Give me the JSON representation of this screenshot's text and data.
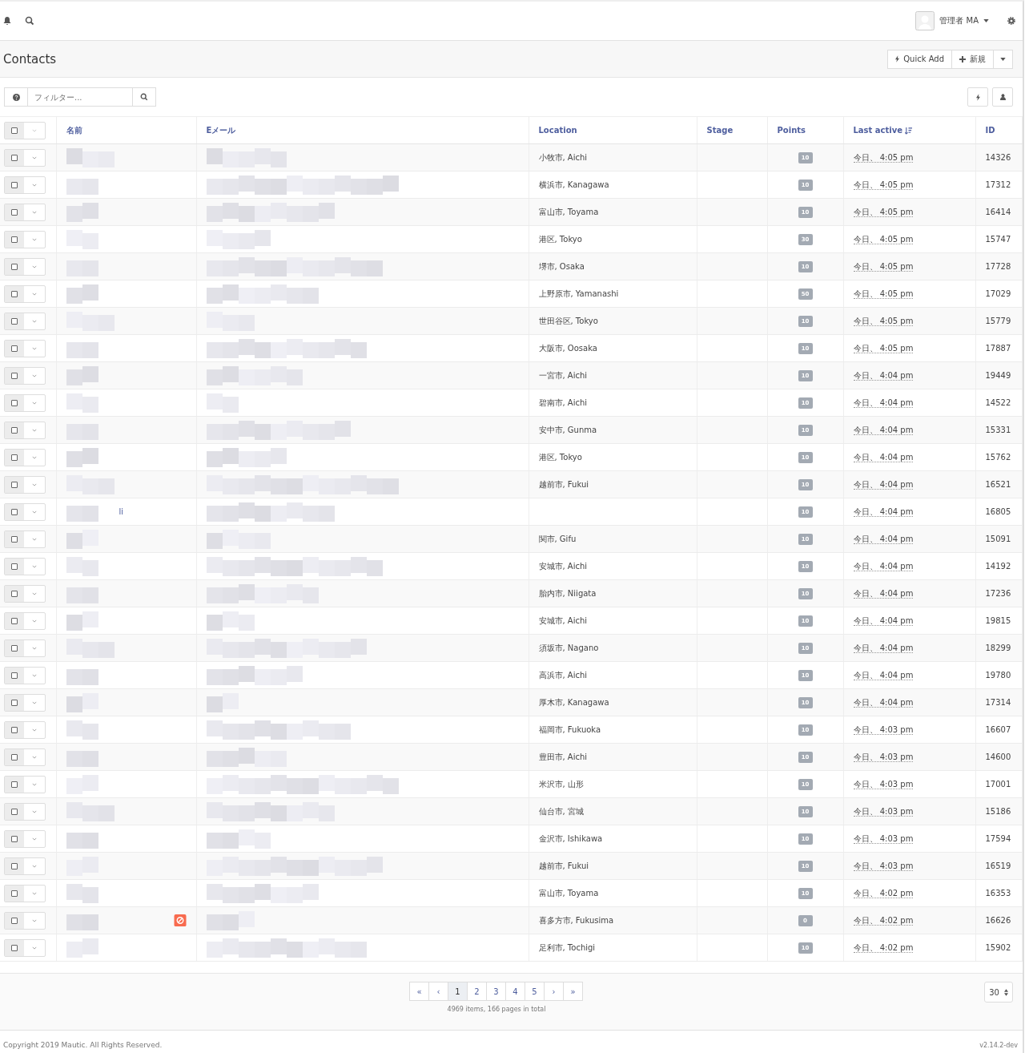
{
  "topbar": {
    "user_name": "管理者 MA"
  },
  "page": {
    "title": "Contacts",
    "buttons": [
      {
        "kind": "quick",
        "label": "Quick Add"
      },
      {
        "kind": "new",
        "label": "新規"
      }
    ]
  },
  "filter": {
    "placeholder": "フィルター..."
  },
  "table": {
    "columns": [
      "名前",
      "Eメール",
      "Location",
      "Stage",
      "Points",
      "Last active",
      "ID"
    ],
    "rows": [
      {
        "name": "",
        "location": "小牧市, Aichi",
        "points": "10",
        "last_active": "今日、 4:05 pm",
        "id": "14326",
        "do_not_contact": false
      },
      {
        "name": "",
        "location": "横浜市, Kanagawa",
        "points": "10",
        "last_active": "今日、 4:05 pm",
        "id": "17312",
        "do_not_contact": false
      },
      {
        "name": "",
        "location": "富山市, Toyama",
        "points": "10",
        "last_active": "今日、 4:05 pm",
        "id": "16414",
        "do_not_contact": false
      },
      {
        "name": "",
        "location": "港区, Tokyo",
        "points": "30",
        "last_active": "今日、 4:05 pm",
        "id": "15747",
        "do_not_contact": false
      },
      {
        "name": "",
        "location": "堺市, Osaka",
        "points": "10",
        "last_active": "今日、 4:05 pm",
        "id": "17728",
        "do_not_contact": false
      },
      {
        "name": "",
        "location": "上野原市, Yamanashi",
        "points": "50",
        "last_active": "今日、 4:05 pm",
        "id": "17029",
        "do_not_contact": false
      },
      {
        "name": "",
        "location": "世田谷区, Tokyo",
        "points": "10",
        "last_active": "今日、 4:05 pm",
        "id": "15779",
        "do_not_contact": false
      },
      {
        "name": "",
        "location": "大阪市, Oosaka",
        "points": "10",
        "last_active": "今日、 4:05 pm",
        "id": "17887",
        "do_not_contact": false
      },
      {
        "name": "",
        "location": "一宮市, Aichi",
        "points": "10",
        "last_active": "今日、 4:04 pm",
        "id": "19449",
        "do_not_contact": false
      },
      {
        "name": "",
        "location": "碧南市, Aichi",
        "points": "10",
        "last_active": "今日、 4:04 pm",
        "id": "14522",
        "do_not_contact": false
      },
      {
        "name": "",
        "location": "安中市, Gunma",
        "points": "10",
        "last_active": "今日、 4:04 pm",
        "id": "15331",
        "do_not_contact": false
      },
      {
        "name": "",
        "location": "港区, Tokyo",
        "points": "10",
        "last_active": "今日、 4:04 pm",
        "id": "15762",
        "do_not_contact": false
      },
      {
        "name": "",
        "location": "越前市, Fukui",
        "points": "10",
        "last_active": "今日、 4:04 pm",
        "id": "16521",
        "do_not_contact": false
      },
      {
        "name": "li",
        "location": "",
        "points": "10",
        "last_active": "今日、 4:04 pm",
        "id": "16805",
        "do_not_contact": false
      },
      {
        "name": "",
        "location": "関市, Gifu",
        "points": "10",
        "last_active": "今日、 4:04 pm",
        "id": "15091",
        "do_not_contact": false
      },
      {
        "name": "",
        "location": "安城市, Aichi",
        "points": "10",
        "last_active": "今日、 4:04 pm",
        "id": "14192",
        "do_not_contact": false
      },
      {
        "name": "",
        "location": "胎内市, Niigata",
        "points": "10",
        "last_active": "今日、 4:04 pm",
        "id": "17236",
        "do_not_contact": false
      },
      {
        "name": "",
        "location": "安城市, Aichi",
        "points": "10",
        "last_active": "今日、 4:04 pm",
        "id": "19815",
        "do_not_contact": false
      },
      {
        "name": "",
        "location": "須坂市, Nagano",
        "points": "10",
        "last_active": "今日、 4:04 pm",
        "id": "18299",
        "do_not_contact": false
      },
      {
        "name": "",
        "location": "高浜市, Aichi",
        "points": "10",
        "last_active": "今日、 4:04 pm",
        "id": "19780",
        "do_not_contact": false
      },
      {
        "name": "",
        "location": "厚木市, Kanagawa",
        "points": "10",
        "last_active": "今日、 4:04 pm",
        "id": "17314",
        "do_not_contact": false
      },
      {
        "name": "",
        "location": "福岡市, Fukuoka",
        "points": "10",
        "last_active": "今日、 4:03 pm",
        "id": "16607",
        "do_not_contact": false
      },
      {
        "name": "",
        "location": "豊田市, Aichi",
        "points": "10",
        "last_active": "今日、 4:03 pm",
        "id": "14600",
        "do_not_contact": false
      },
      {
        "name": "",
        "location": "米沢市, 山形",
        "points": "10",
        "last_active": "今日、 4:03 pm",
        "id": "17001",
        "do_not_contact": false
      },
      {
        "name": "",
        "location": "仙台市, 宮城",
        "points": "10",
        "last_active": "今日、 4:03 pm",
        "id": "15186",
        "do_not_contact": false
      },
      {
        "name": "",
        "location": "金沢市, Ishikawa",
        "points": "10",
        "last_active": "今日、 4:03 pm",
        "id": "17594",
        "do_not_contact": false
      },
      {
        "name": "",
        "location": "越前市, Fukui",
        "points": "10",
        "last_active": "今日、 4:03 pm",
        "id": "16519",
        "do_not_contact": false
      },
      {
        "name": "",
        "location": "富山市, Toyama",
        "points": "10",
        "last_active": "今日、 4:02 pm",
        "id": "16353",
        "do_not_contact": false
      },
      {
        "name": "",
        "location": "喜多方市, Fukusima",
        "points": "0",
        "last_active": "今日、 4:02 pm",
        "id": "16626",
        "do_not_contact": true
      },
      {
        "name": "",
        "location": "足利市, Tochigi",
        "points": "10",
        "last_active": "今日、 4:02 pm",
        "id": "15902",
        "do_not_contact": false
      }
    ]
  },
  "pagination": {
    "pages": [
      {
        "label": "«",
        "selected": false
      },
      {
        "label": "‹",
        "selected": false
      },
      {
        "label": "1",
        "selected": true
      },
      {
        "label": "2",
        "selected": false
      },
      {
        "label": "3",
        "selected": false
      },
      {
        "label": "4",
        "selected": false
      },
      {
        "label": "5",
        "selected": false
      },
      {
        "label": "›",
        "selected": false
      },
      {
        "label": "»",
        "selected": false
      }
    ],
    "summary": "4969 items, 166 pages in total",
    "per_page": "30"
  },
  "footer": {
    "copyright": "Copyright 2019 Mautic. All Rights Reserved.",
    "version": "v2.14.2-dev"
  }
}
